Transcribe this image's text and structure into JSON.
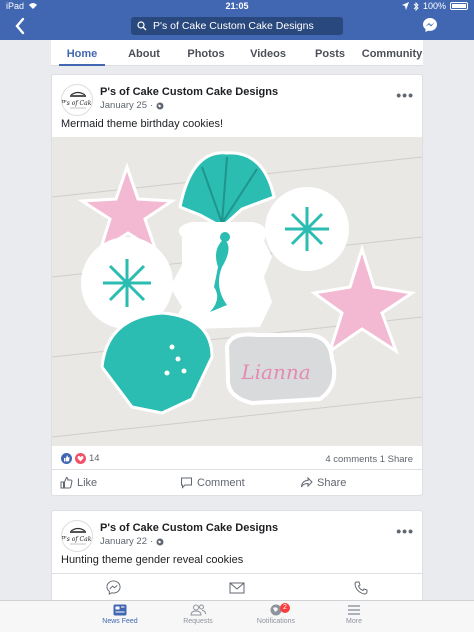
{
  "status": {
    "device": "iPad",
    "time": "21:05",
    "battery": "100%"
  },
  "header": {
    "search_text": "P's of Cake Custom Cake Designs"
  },
  "tabs": [
    {
      "label": "Home",
      "active": true
    },
    {
      "label": "About"
    },
    {
      "label": "Photos"
    },
    {
      "label": "Videos"
    },
    {
      "label": "Posts"
    },
    {
      "label": "Community"
    }
  ],
  "posts": [
    {
      "page_name": "P's of Cake Custom Cake Designs",
      "date": "January 25",
      "text": "Mermaid theme birthday cookies!",
      "photo_text": "Lianna",
      "reaction_count": "14",
      "comments": "4 comments",
      "shares": "1 Share",
      "actions": {
        "like": "Like",
        "comment": "Comment",
        "share": "Share"
      }
    },
    {
      "page_name": "P's of Cake Custom Cake Designs",
      "date": "January 22",
      "text": "Hunting theme gender reveal cookies"
    }
  ],
  "bottom_nav": [
    {
      "label": "News Feed",
      "active": true
    },
    {
      "label": "Requests"
    },
    {
      "label": "Notifications",
      "badge": "2"
    },
    {
      "label": "More"
    }
  ],
  "colors": {
    "brand": "#4267b2",
    "teal": "#2bbcb2",
    "pink": "#f3b9d2",
    "badge": "#fa3e3e"
  }
}
